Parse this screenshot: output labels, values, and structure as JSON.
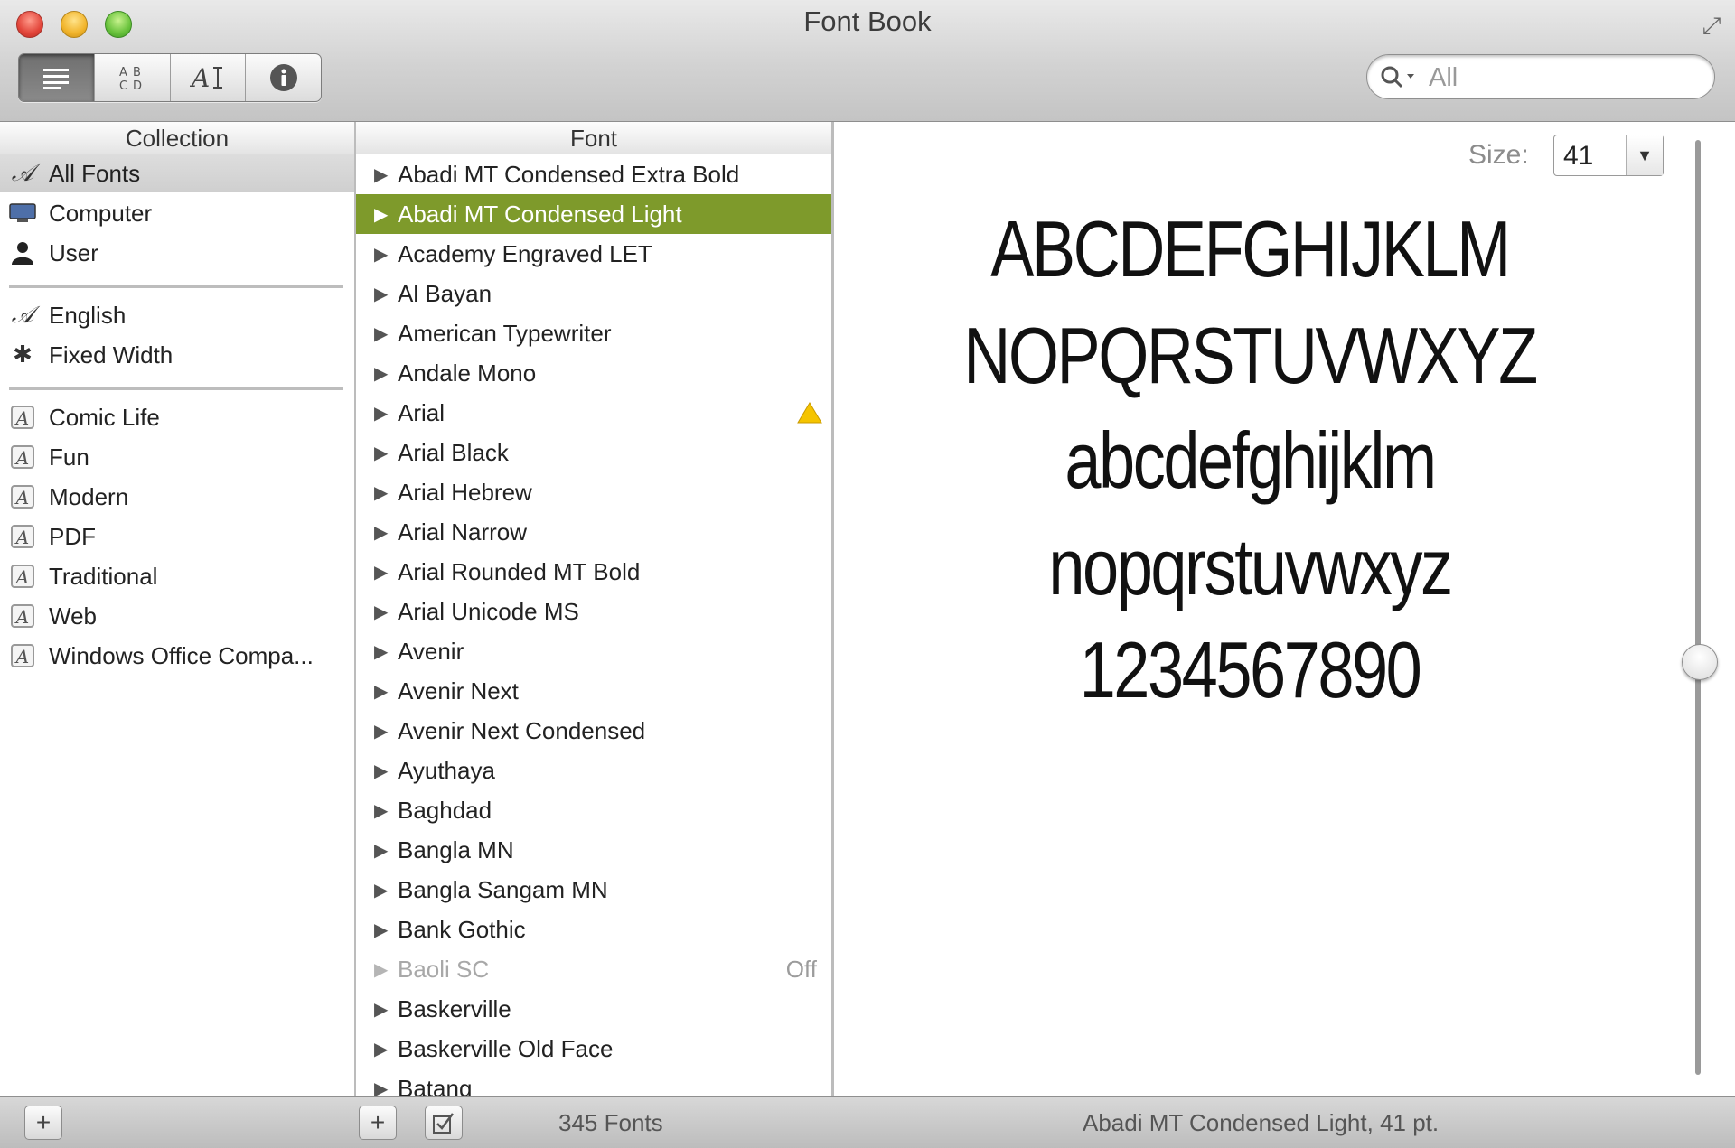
{
  "window": {
    "title": "Font Book"
  },
  "toolbar": {
    "view_buttons": [
      {
        "icon": "list-view-icon"
      },
      {
        "icon": "grid-view-icon"
      },
      {
        "icon": "custom-text-icon"
      },
      {
        "icon": "info-icon"
      }
    ],
    "search": {
      "value": "All",
      "icon": "search-icon"
    }
  },
  "collection": {
    "header": "Collection",
    "groups": [
      [
        {
          "label": "All Fonts",
          "icon": "script-a-icon",
          "selected": true
        },
        {
          "label": "Computer",
          "icon": "computer-icon"
        },
        {
          "label": "User",
          "icon": "user-icon"
        }
      ],
      [
        {
          "label": "English",
          "icon": "script-a-icon"
        },
        {
          "label": "Fixed Width",
          "icon": "gear-icon"
        }
      ],
      [
        {
          "label": "Comic Life",
          "icon": "collection-icon"
        },
        {
          "label": "Fun",
          "icon": "collection-icon"
        },
        {
          "label": "Modern",
          "icon": "collection-icon"
        },
        {
          "label": "PDF",
          "icon": "collection-icon"
        },
        {
          "label": "Traditional",
          "icon": "collection-icon"
        },
        {
          "label": "Web",
          "icon": "collection-icon"
        },
        {
          "label": "Windows Office Compa...",
          "icon": "collection-icon"
        }
      ]
    ]
  },
  "fonts": {
    "header": "Font",
    "items": [
      {
        "name": "Abadi MT Condensed Extra Bold"
      },
      {
        "name": "Abadi MT Condensed Light",
        "selected": true
      },
      {
        "name": "Academy Engraved LET"
      },
      {
        "name": "Al Bayan"
      },
      {
        "name": "American Typewriter"
      },
      {
        "name": "Andale Mono"
      },
      {
        "name": "Arial",
        "warning": true
      },
      {
        "name": "Arial Black"
      },
      {
        "name": "Arial Hebrew"
      },
      {
        "name": "Arial Narrow"
      },
      {
        "name": "Arial Rounded MT Bold"
      },
      {
        "name": "Arial Unicode MS"
      },
      {
        "name": "Avenir"
      },
      {
        "name": "Avenir Next"
      },
      {
        "name": "Avenir Next Condensed"
      },
      {
        "name": "Ayuthaya"
      },
      {
        "name": "Baghdad"
      },
      {
        "name": "Bangla MN"
      },
      {
        "name": "Bangla Sangam MN"
      },
      {
        "name": "Bank Gothic"
      },
      {
        "name": "Baoli SC",
        "disabled": true,
        "status": "Off"
      },
      {
        "name": "Baskerville"
      },
      {
        "name": "Baskerville Old Face"
      },
      {
        "name": "Batang"
      }
    ]
  },
  "preview": {
    "size_label": "Size:",
    "size_value": "41",
    "sample_lines": [
      "ABCDEFGHIJKLM",
      "NOPQRSTUVWXYZ",
      "abcdefghijklm",
      "nopqrstuvwxyz",
      "1234567890"
    ]
  },
  "status": {
    "font_count": "345 Fonts",
    "selection": "Abadi MT Condensed Light, 41 pt."
  },
  "colors": {
    "selection_green": "#7e9a2b",
    "warning_yellow": "#f5c400"
  }
}
